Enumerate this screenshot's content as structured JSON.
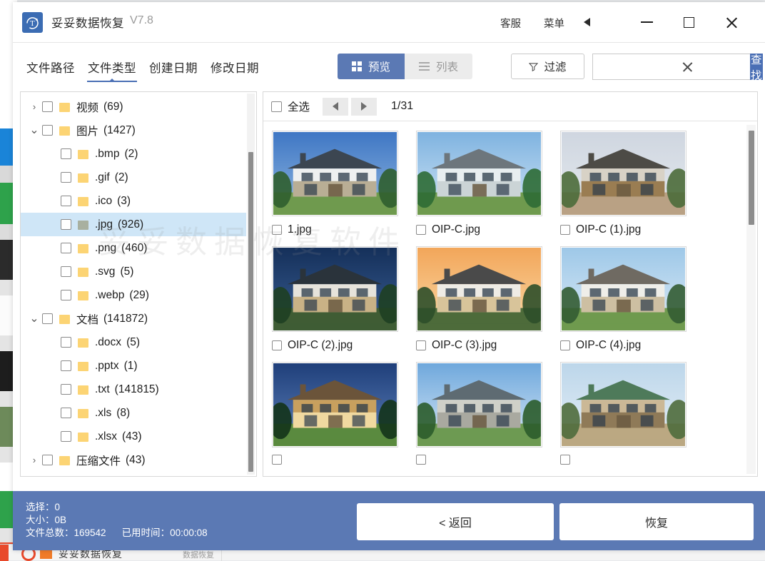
{
  "window": {
    "title": "妥妥数据恢复",
    "version": "V7.8",
    "logo_icon": "refresh-t-logo-icon",
    "support_label": "客服",
    "menu_label": "菜单",
    "menu_arrow_icon": "triangle-left-icon",
    "minimize_icon": "minimize-icon",
    "maximize_icon": "maximize-icon",
    "close_icon": "close-icon"
  },
  "toolbar": {
    "tabs": [
      {
        "label": "文件路径",
        "active": false
      },
      {
        "label": "文件类型",
        "active": true
      },
      {
        "label": "创建日期",
        "active": false
      },
      {
        "label": "修改日期",
        "active": false
      }
    ],
    "view_modes": [
      {
        "label": "预览",
        "icon": "grid-icon",
        "active": true
      },
      {
        "label": "列表",
        "icon": "list-icon",
        "active": false
      }
    ],
    "filter_label": "过滤",
    "filter_icon": "funnel-icon",
    "search_value": "",
    "search_placeholder": "",
    "search_clear_icon": "clear-x-icon",
    "search_button_label": "查找"
  },
  "tree": {
    "items": [
      {
        "chevron": "›",
        "depth": 0,
        "label": "视频",
        "count": "(69)",
        "folder": "yellow",
        "selected": false
      },
      {
        "chevron": "⌄",
        "depth": 0,
        "label": "图片",
        "count": "(1427)",
        "folder": "yellow",
        "selected": false
      },
      {
        "chevron": "",
        "depth": 1,
        "label": ".bmp",
        "count": "(2)",
        "folder": "yellow",
        "selected": false
      },
      {
        "chevron": "",
        "depth": 1,
        "label": ".gif",
        "count": "(2)",
        "folder": "yellow",
        "selected": false
      },
      {
        "chevron": "",
        "depth": 1,
        "label": ".ico",
        "count": "(3)",
        "folder": "yellow",
        "selected": false
      },
      {
        "chevron": "",
        "depth": 1,
        "label": ".jpg",
        "count": "(926)",
        "folder": "gray",
        "selected": true
      },
      {
        "chevron": "",
        "depth": 1,
        "label": ".png",
        "count": "(460)",
        "folder": "yellow",
        "selected": false
      },
      {
        "chevron": "",
        "depth": 1,
        "label": ".svg",
        "count": "(5)",
        "folder": "yellow",
        "selected": false
      },
      {
        "chevron": "",
        "depth": 1,
        "label": ".webp",
        "count": "(29)",
        "folder": "yellow",
        "selected": false
      },
      {
        "chevron": "⌄",
        "depth": 0,
        "label": "文档",
        "count": "(141872)",
        "folder": "yellow",
        "selected": false
      },
      {
        "chevron": "",
        "depth": 1,
        "label": ".docx",
        "count": "(5)",
        "folder": "yellow",
        "selected": false
      },
      {
        "chevron": "",
        "depth": 1,
        "label": ".pptx",
        "count": "(1)",
        "folder": "yellow",
        "selected": false
      },
      {
        "chevron": "",
        "depth": 1,
        "label": ".txt",
        "count": "(141815)",
        "folder": "yellow",
        "selected": false
      },
      {
        "chevron": "",
        "depth": 1,
        "label": ".xls",
        "count": "(8)",
        "folder": "yellow",
        "selected": false
      },
      {
        "chevron": "",
        "depth": 1,
        "label": ".xlsx",
        "count": "(43)",
        "folder": "yellow",
        "selected": false
      },
      {
        "chevron": "›",
        "depth": 0,
        "label": "压缩文件",
        "count": "(43)",
        "folder": "yellow",
        "selected": false
      }
    ]
  },
  "preview": {
    "select_all_label": "全选",
    "prev_icon": "triangle-left-icon",
    "next_icon": "triangle-right-icon",
    "page_indicator": "1/31",
    "thumbnails": [
      {
        "name": "1.jpg",
        "scene": "house-a"
      },
      {
        "name": "OIP-C.jpg",
        "scene": "house-b"
      },
      {
        "name": "OIP-C (1).jpg",
        "scene": "house-c"
      },
      {
        "name": "OIP-C (2).jpg",
        "scene": "house-d"
      },
      {
        "name": "OIP-C (3).jpg",
        "scene": "house-e"
      },
      {
        "name": "OIP-C (4).jpg",
        "scene": "house-f"
      },
      {
        "name": "",
        "scene": "house-g"
      },
      {
        "name": "",
        "scene": "house-h"
      },
      {
        "name": "",
        "scene": "house-i"
      }
    ]
  },
  "status": {
    "selected_label": "选择：",
    "selected_value": "0",
    "size_label": "大小：",
    "size_value": "0B",
    "total_label": "文件总数：",
    "total_value": "169542",
    "elapsed_label": "已用时间：",
    "elapsed_value": "00:00:08"
  },
  "actions": {
    "back_label": "< 返回",
    "recover_label": "恢复"
  },
  "background": {
    "taskbar_text": "妥妥数据恢复",
    "taskbar_sub": "数据恢复"
  },
  "colors": {
    "accent": "#4a6fb5",
    "bottom_bar": "#5b79b4",
    "selection": "#cfe6f7",
    "folder_yellow": "#fcd474"
  }
}
